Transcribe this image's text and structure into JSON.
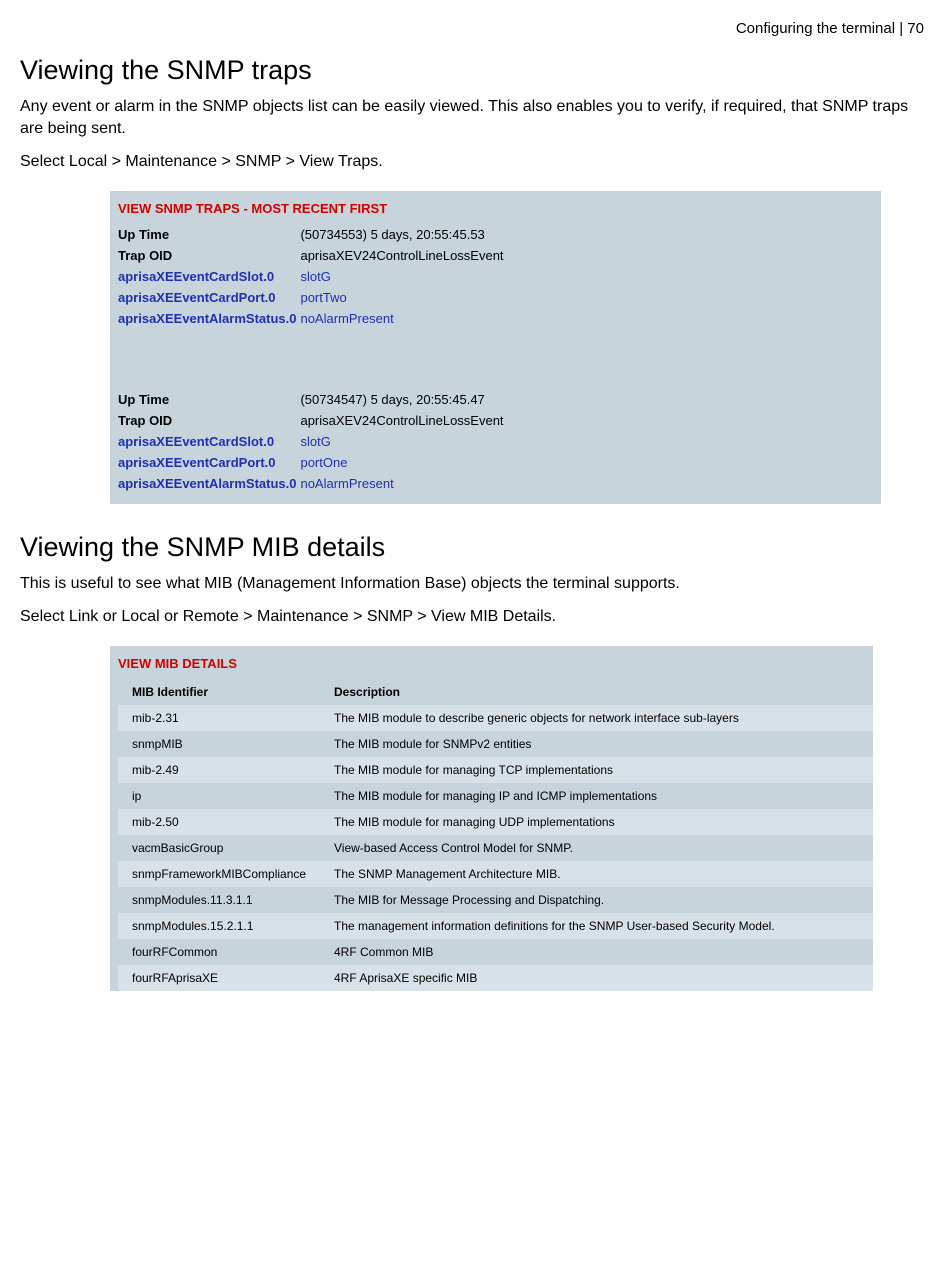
{
  "header": {
    "breadcrumb": "Configuring the terminal  |  70"
  },
  "section1": {
    "title": "Viewing the SNMP traps",
    "para1": "Any event or alarm in the SNMP objects list can be easily viewed. This also enables you to verify, if required, that SNMP traps are being sent.",
    "para2": "Select Local > Maintenance > SNMP > View Traps."
  },
  "traps_panel": {
    "title": "VIEW SNMP TRAPS - MOST RECENT FIRST",
    "trap1": {
      "uptime_label": "Up Time",
      "uptime_value": "(50734553) 5 days, 20:55:45.53",
      "oid_label": "Trap OID",
      "oid_value": "aprisaXEV24ControlLineLossEvent",
      "slot_label": "aprisaXEEventCardSlot.0",
      "slot_value": "slotG",
      "port_label": "aprisaXEEventCardPort.0",
      "port_value": "portTwo",
      "alarm_label": "aprisaXEEventAlarmStatus.0",
      "alarm_value": "noAlarmPresent"
    },
    "trap2": {
      "uptime_label": "Up Time",
      "uptime_value": "(50734547) 5 days, 20:55:45.47",
      "oid_label": "Trap OID",
      "oid_value": "aprisaXEV24ControlLineLossEvent",
      "slot_label": "aprisaXEEventCardSlot.0",
      "slot_value": "slotG",
      "port_label": "aprisaXEEventCardPort.0",
      "port_value": "portOne",
      "alarm_label": "aprisaXEEventAlarmStatus.0",
      "alarm_value": "noAlarmPresent"
    }
  },
  "section2": {
    "title": "Viewing the SNMP MIB details",
    "para1": "This is useful to see what MIB (Management Information Base) objects the terminal supports.",
    "para2": "Select Link or Local or Remote > Maintenance > SNMP > View MIB Details."
  },
  "mib_panel": {
    "title": "VIEW MIB DETAILS",
    "col_id": "MIB Identifier",
    "col_desc": "Description",
    "rows": [
      {
        "id": "mib-2.31",
        "desc": "The MIB module to describe generic objects for network interface sub-layers"
      },
      {
        "id": "snmpMIB",
        "desc": "The MIB module for SNMPv2 entities"
      },
      {
        "id": "mib-2.49",
        "desc": "The MIB module for managing TCP implementations"
      },
      {
        "id": "ip",
        "desc": "The MIB module for managing IP and ICMP implementations"
      },
      {
        "id": "mib-2.50",
        "desc": "The MIB module for managing UDP implementations"
      },
      {
        "id": "vacmBasicGroup",
        "desc": "View-based Access Control Model for SNMP."
      },
      {
        "id": "snmpFrameworkMIBCompliance",
        "desc": "The SNMP Management Architecture MIB."
      },
      {
        "id": "snmpModules.11.3.1.1",
        "desc": "The MIB for Message Processing and Dispatching."
      },
      {
        "id": "snmpModules.15.2.1.1",
        "desc": "The management information definitions for the SNMP User-based Security Model."
      },
      {
        "id": "fourRFCommon",
        "desc": "4RF Common MIB"
      },
      {
        "id": "fourRFAprisaXE",
        "desc": "4RF AprisaXE specific MIB"
      }
    ]
  }
}
